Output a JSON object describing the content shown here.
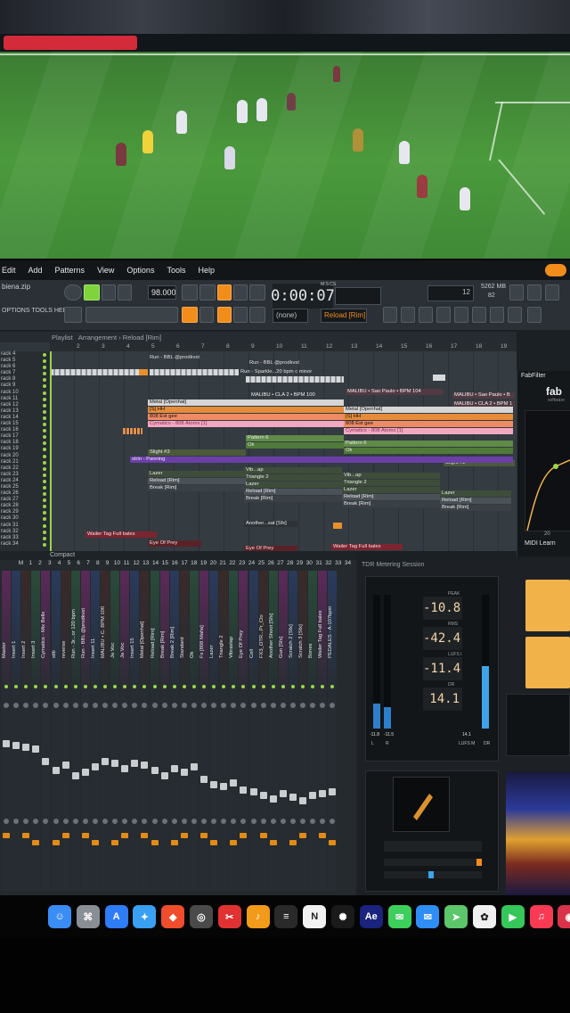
{
  "menu": {
    "items": [
      "Edit",
      "Add",
      "Patterns",
      "View",
      "Options",
      "Tools",
      "Help"
    ]
  },
  "toolbar": {
    "file_name": "biena.zip",
    "tempo": "98.000",
    "time": "0:00:07",
    "time_unit": "M:S:CS",
    "snap": "(none)",
    "pattern": "Reload [Rim]",
    "options_label": "OPTIONS TOOLS HELP",
    "memory": "5262 MB",
    "cpu": "12",
    "poly": "82"
  },
  "playlist": {
    "header_prefix": "Playlist",
    "header": "Arrangement › Reload [Rim]",
    "ruler": [
      "2",
      "3",
      "4",
      "5",
      "6",
      "7",
      "8",
      "9",
      "10",
      "11",
      "12",
      "13",
      "14",
      "15",
      "16",
      "17",
      "18",
      "19"
    ],
    "tracks": [
      "rack 4",
      "rack 5",
      "rack 6",
      "rack 7",
      "rack 8",
      "rack 9",
      "rack 10",
      "rack 11",
      "rack 12",
      "rack 13",
      "rack 14",
      "rack 15",
      "rack 16",
      "rack 17",
      "rack 18",
      "rack 19",
      "rack 20",
      "rack 21",
      "rack 22",
      "rack 23",
      "rack 24",
      "rack 25",
      "rack 26",
      "rack 27",
      "rack 28",
      "rack 29",
      "rack 30",
      "rack 31",
      "rack 32",
      "rack 33",
      "rack 34"
    ],
    "clips": {
      "run_bbl_a": "Run - BBL @prodkvst",
      "run_bbl_b": "Run - BBL @prodkvst",
      "run_sparkle": "Run - Sparkle...20 bpm c minor",
      "malibu_a": "MALIBU • CLA 2 • BPM 100",
      "malibu_b": "MALIBU • Sao Paulo • BPM 104",
      "malibu_c": "MALIBU • Sao Paulo • B",
      "malibu_d": "MALIBU • CLA 2 • BPM 1",
      "metal_a": "Metal [Openhat]",
      "metal_b": "Metal [Openhat]",
      "hh_a": "[S] HH",
      "hh_b": "[S] HH",
      "gee_a": "808 Est gee",
      "gee_b": "808 Est gee",
      "cym_a": "Cymatics - 808 Atoms [1]",
      "cym_b": "Cymatics - 808 Atoms [1]",
      "pat6_a": "Pattern 6",
      "pat6_b": "Pattern 6",
      "ok_a": "Ok",
      "ok_b": "Ok",
      "slight_a": "Slight #3",
      "slight_b": "Slight #2",
      "strin": "strin - Panning",
      "lazer_a": "Lazer",
      "lazer_b": "Lazer",
      "lazer_c": "Lazer",
      "lazer_d": "Lazer",
      "reload_a": "Reload [Rim]",
      "reload_b": "Reload [Rim]",
      "reload_c": "Reload [Rim]",
      "reload_d": "Reload [Rim]",
      "break_a": "Break [Rim]",
      "break_b": "Break [Rim]",
      "break_c": "Break [Rim]",
      "break_d": "Break [Rim]",
      "vib_a": "Vib...ap",
      "vib_b": "Vib...ap",
      "tri_a": "Triangle 2",
      "tri_b": "Triangle 2",
      "another": "Another...sat [Sfx]",
      "wailer_a": "Wailer Tag Full bales",
      "wailer_b": "Wailer Tag Full bales",
      "eye_a": "Eye Of Prey",
      "eye_b": "Eye Of Prey"
    }
  },
  "fabfilter": {
    "title": "FabFilter",
    "logo": "fab",
    "sub": "software",
    "footer": "MIDI Learn",
    "axis": "20"
  },
  "mixer": {
    "view_label": "Compact",
    "numbers": [
      "M",
      "1",
      "2",
      "3",
      "4",
      "5",
      "6",
      "7",
      "8",
      "9",
      "10",
      "11",
      "12",
      "13",
      "14",
      "15",
      "16",
      "17",
      "18",
      "19",
      "20",
      "21",
      "22",
      "23",
      "24",
      "25",
      "26",
      "27",
      "28",
      "29",
      "30",
      "31",
      "32",
      "33",
      "34"
    ],
    "channels": [
      "Master",
      "Insert 1",
      "Insert 2",
      "Insert 3",
      "Cymatics - Mix Bells",
      "sitti",
      "reverse",
      "Run - 3r...or 120 bpm",
      "Run - BBL @prodkvst",
      "Insert 11",
      "MALIBU • C. BPM 100",
      "Ja Voc",
      "Ja Voc",
      "Insert 15",
      "Metal [Openhat]",
      "Reload [Rim]",
      "Break [Rim]",
      "Break 2 [Rim]",
      "Standard",
      "Ok",
      "Fx [808 Mafia]",
      "Lazer",
      "Triangle 2",
      "Vibraslap",
      "Eye Of Prey",
      "Cell",
      "FX3_OTR...Pr_Clo",
      "Another Shoot [Sfx]",
      "Gun [Sfx]",
      "Scratch 2 [Sfx]",
      "Scratch 3 [Sfx]",
      "Bones",
      "Wailer Tag Full bales",
      "PEDALES - A-107bpm"
    ]
  },
  "metering": {
    "title": "TDR Metering Session",
    "peak_label": "PEAK",
    "rms_label": "RMS",
    "lufs_label": "LUFS I",
    "dr_label": "DR",
    "peak": "-10.8",
    "rms": "-42.4",
    "lufs": "-11.4",
    "dr": "14.1",
    "lr_left": "-11.8",
    "lr_right": "-11.5",
    "lufs_m": "14.1",
    "ch_l": "L",
    "ch_r": "R",
    "lufs_foot": "LUFS M",
    "dr_foot": "DR"
  },
  "dock": {
    "icons": [
      "finder-icon",
      "launchpad-icon",
      "app-store-icon",
      "safari-icon",
      "brave-icon",
      "unity-icon",
      "capcut-icon",
      "fl-studio-icon",
      "mixer-icon",
      "notion-icon",
      "chatgpt-icon",
      "ae-icon",
      "messages-icon",
      "mail-icon",
      "maps-icon",
      "photos-icon",
      "facetime-icon",
      "music-icon",
      "photo-booth-icon"
    ],
    "colors": [
      "#3b8df6",
      "#8a8f96",
      "#2e7cf6",
      "#3aa0f3",
      "#ef4d2c",
      "#4a4a4a",
      "#e03232",
      "#f29a1a",
      "#2a2a2a",
      "#f2f2f2",
      "#1a1a1a",
      "#1a237e",
      "#3ccf5c",
      "#2f8ef5",
      "#5cc66a",
      "#f0f0f0",
      "#35c759",
      "#fa3a53",
      "#d8334a"
    ],
    "glyphs": [
      "☺",
      "⌘",
      "A",
      "✦",
      "◆",
      "◎",
      "✂",
      "♪",
      "≡",
      "N",
      "✺",
      "Ae",
      "✉",
      "✉",
      "➤",
      "✿",
      "▶",
      "♫",
      "◉"
    ]
  }
}
